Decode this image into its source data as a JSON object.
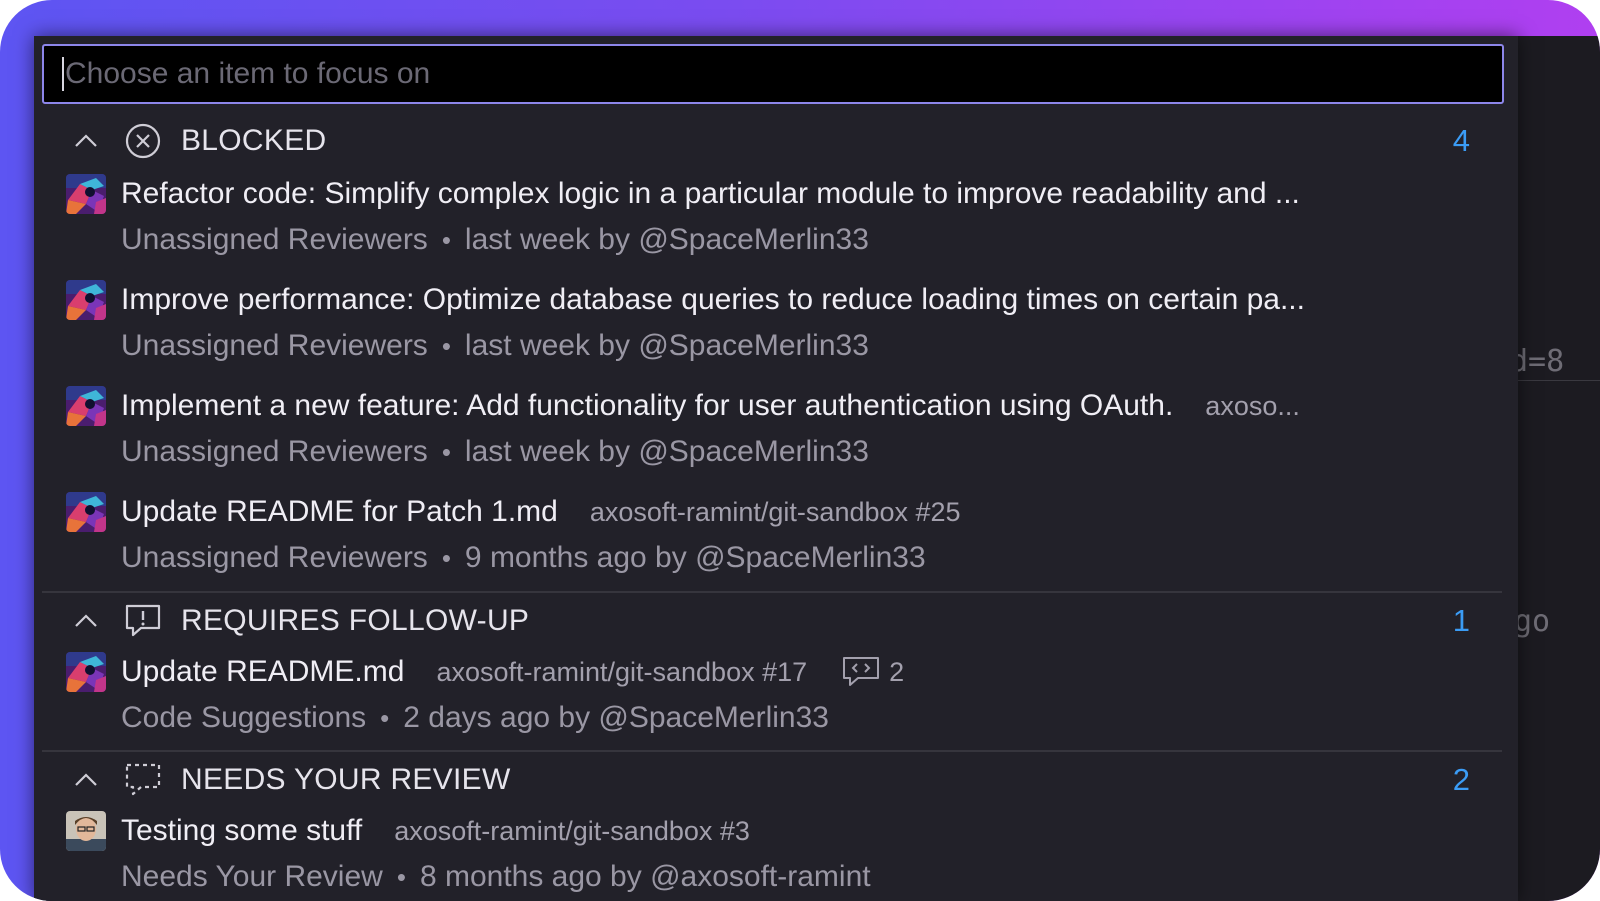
{
  "search": {
    "placeholder": "Choose an item to focus on",
    "value": ""
  },
  "background_fragments": [
    "d=8",
    "go"
  ],
  "sections": [
    {
      "title": "BLOCKED",
      "icon": "circle-x-icon",
      "count": "4",
      "items": [
        {
          "title": "Refactor code: Simplify complex logic in a particular module to improve readability and ...",
          "repo": "",
          "status": "Unassigned Reviewers",
          "time": "last week by @SpaceMerlin33",
          "avatar": "space-avatar"
        },
        {
          "title": "Improve performance: Optimize database queries to reduce loading times on certain pa...",
          "repo": "",
          "status": "Unassigned Reviewers",
          "time": "last week by @SpaceMerlin33",
          "avatar": "space-avatar"
        },
        {
          "title": "Implement a new feature: Add functionality for user authentication using OAuth.",
          "repo": "axoso...",
          "status": "Unassigned Reviewers",
          "time": "last week by @SpaceMerlin33",
          "avatar": "space-avatar"
        },
        {
          "title": "Update README for Patch 1.md",
          "repo": "axosoft-ramint/git-sandbox #25",
          "status": "Unassigned Reviewers",
          "time": "9 months ago by @SpaceMerlin33",
          "avatar": "space-avatar"
        }
      ]
    },
    {
      "title": "REQUIRES FOLLOW-UP",
      "icon": "comment-alert-icon",
      "count": "1",
      "items": [
        {
          "title": "Update README.md",
          "repo": "axosoft-ramint/git-sandbox #17",
          "comments": "2",
          "status": "Code Suggestions",
          "time": "2 days ago by @SpaceMerlin33",
          "avatar": "space-avatar"
        }
      ]
    },
    {
      "title": "NEEDS YOUR REVIEW",
      "icon": "comment-dashed-icon",
      "count": "2",
      "items": [
        {
          "title": "Testing some stuff",
          "repo": "axosoft-ramint/git-sandbox #3",
          "status": "Needs Your Review",
          "time": "8 months ago by @axosoft-ramint",
          "avatar": "person-avatar"
        }
      ]
    }
  ],
  "colors": {
    "accent": "#3b9cf5",
    "focus_border": "#8d86ea",
    "panel": "#222129",
    "gradient_start": "#5d55f2",
    "gradient_end": "#b03ff0"
  }
}
